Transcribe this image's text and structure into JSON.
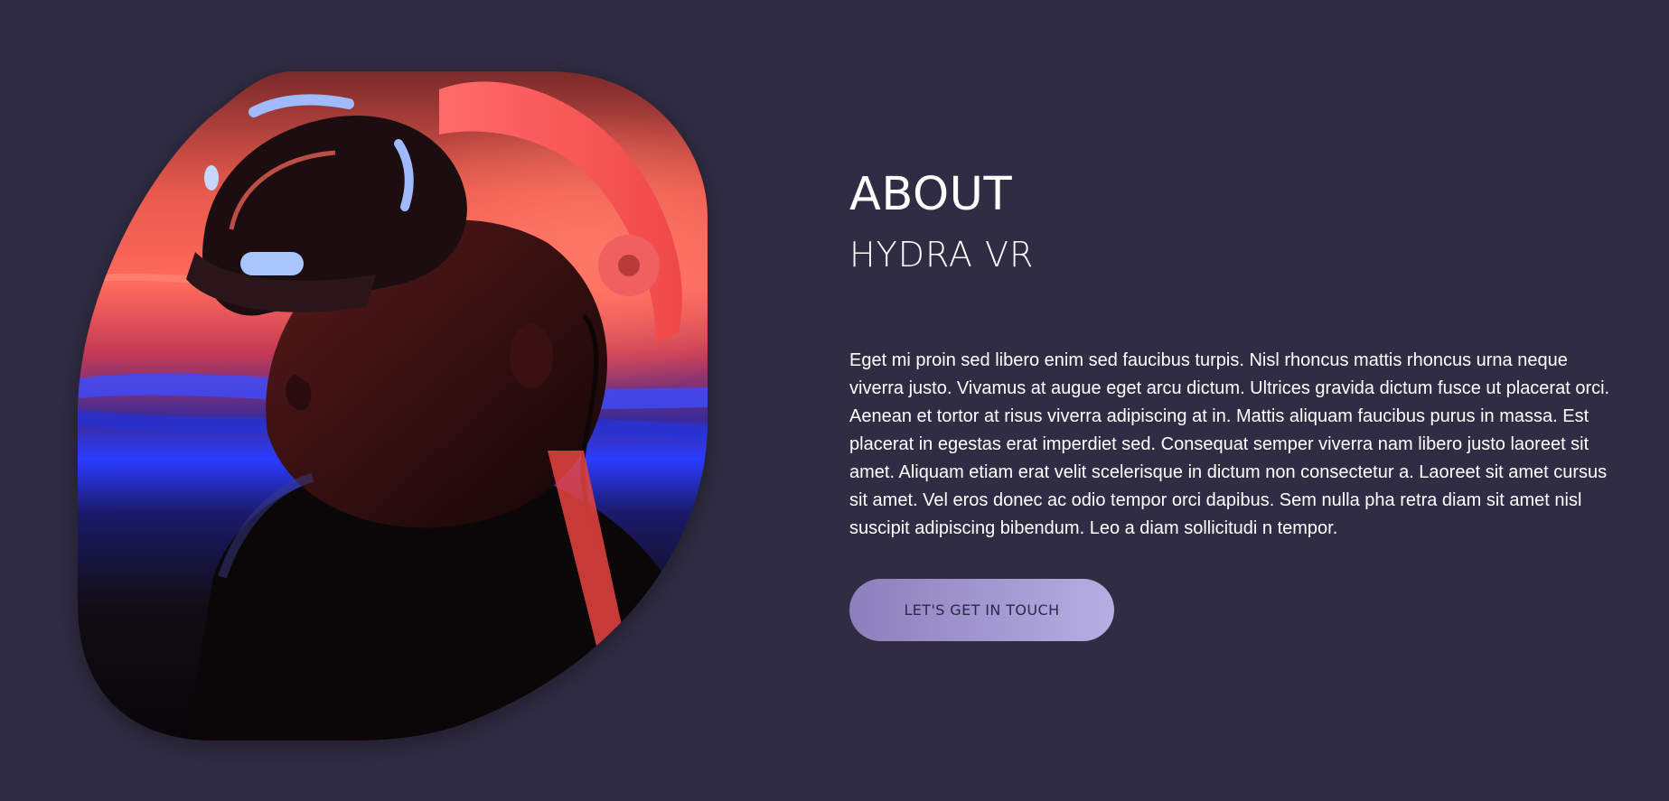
{
  "about": {
    "title": "ABOUT",
    "subtitle": "HYDRA VR",
    "body": "Eget mi proin sed libero enim sed faucibus turpis. Nisl rhoncus mattis rhoncus urna neque viverra justo. Vivamus at augue eget arcu dictum. Ultrices gravida dictum fusce ut placerat orci. Aenean et tortor at risus viverra adipiscing at in. Mattis aliquam faucibus purus in massa. Est placerat in egestas erat imperdiet sed. Consequat semper viverra nam libero justo laoreet sit amet. Aliquam etiam erat velit scelerisque in dictum non consectetur a. Laoreet sit amet cursus sit amet. Vel eros donec ac odio tempor orci dapibus. Sem nulla pha retra diam sit amet nisl suscipit adipiscing bibendum. Leo a diam sollicitudi n tempor.",
    "cta_label": "LET'S GET IN TOUCH"
  },
  "colors": {
    "background": "#302c43",
    "cta_gradient_start": "#8c7fbc",
    "cta_gradient_end": "#b6aee3",
    "headset_glow": "#8fb0ff",
    "neon_red": "#ff4a4a",
    "neon_blue": "#2b3cff"
  },
  "image": {
    "subject": "person-wearing-vr-headset"
  }
}
